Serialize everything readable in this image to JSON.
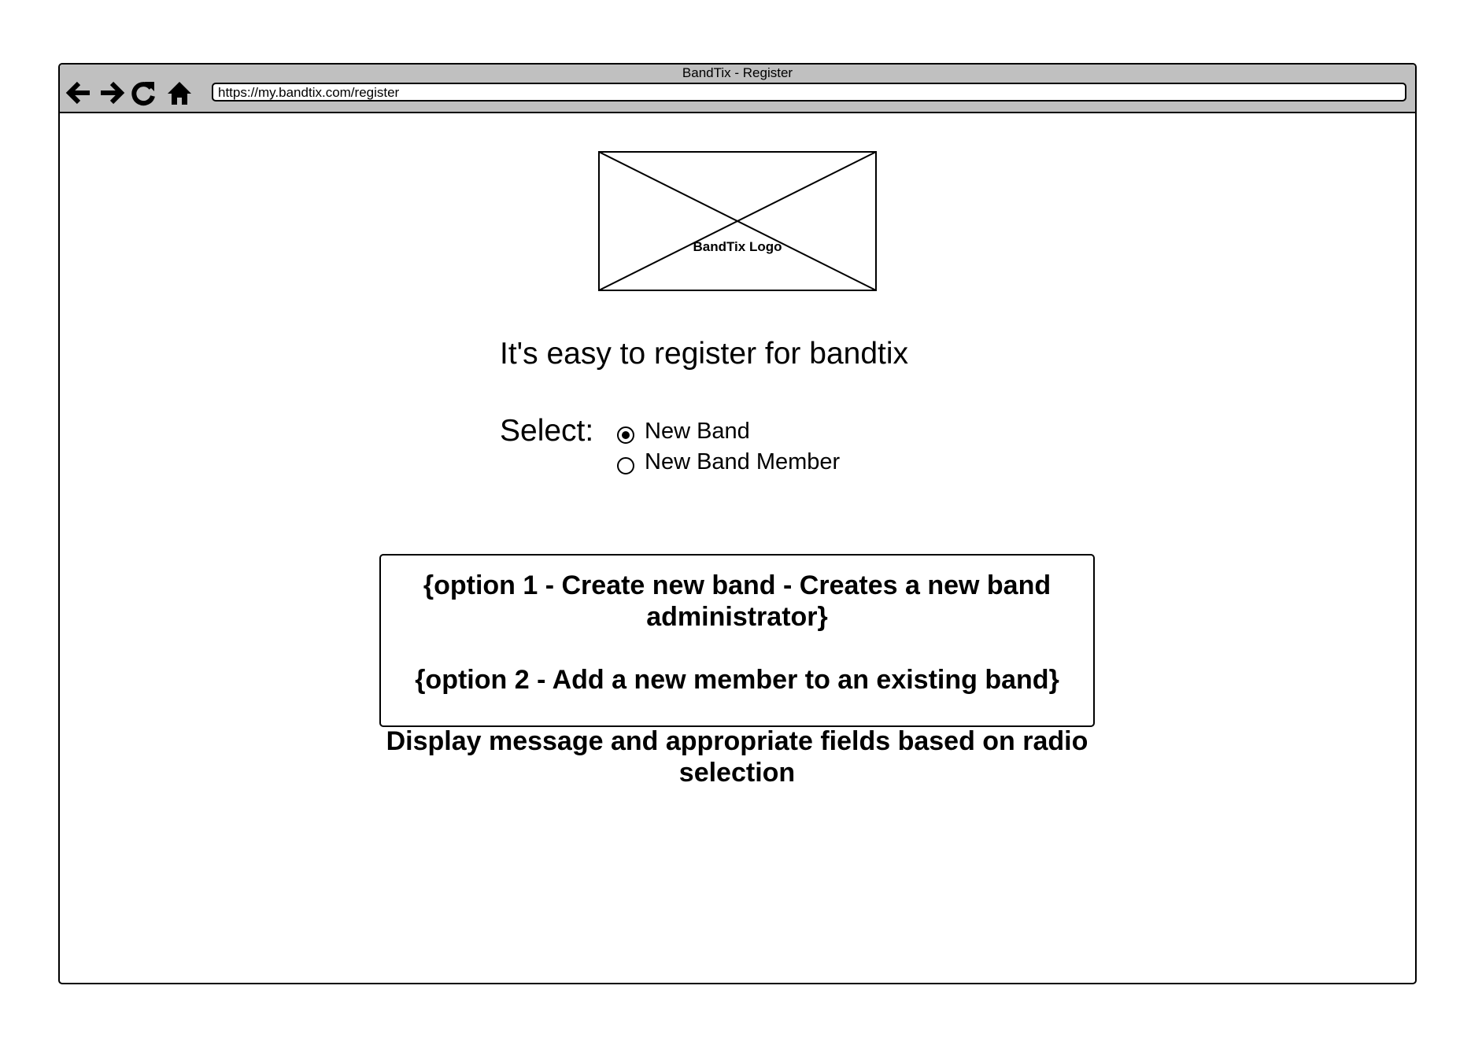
{
  "browser": {
    "title": "BandTix - Register",
    "url": "https://my.bandtix.com/register"
  },
  "logo": {
    "label": "BandTix Logo"
  },
  "heading": "It's easy to register for bandtix",
  "select_label": "Select:",
  "options": [
    {
      "label": "New Band",
      "selected": true
    },
    {
      "label": "New Band Member",
      "selected": false
    }
  ],
  "message_box": {
    "option1": "{option 1 - Create new band - Creates a new band administrator}",
    "option2": "{option 2 - Add a new member to an existing band}"
  },
  "caption": "Display message and appropriate fields based on radio selection"
}
